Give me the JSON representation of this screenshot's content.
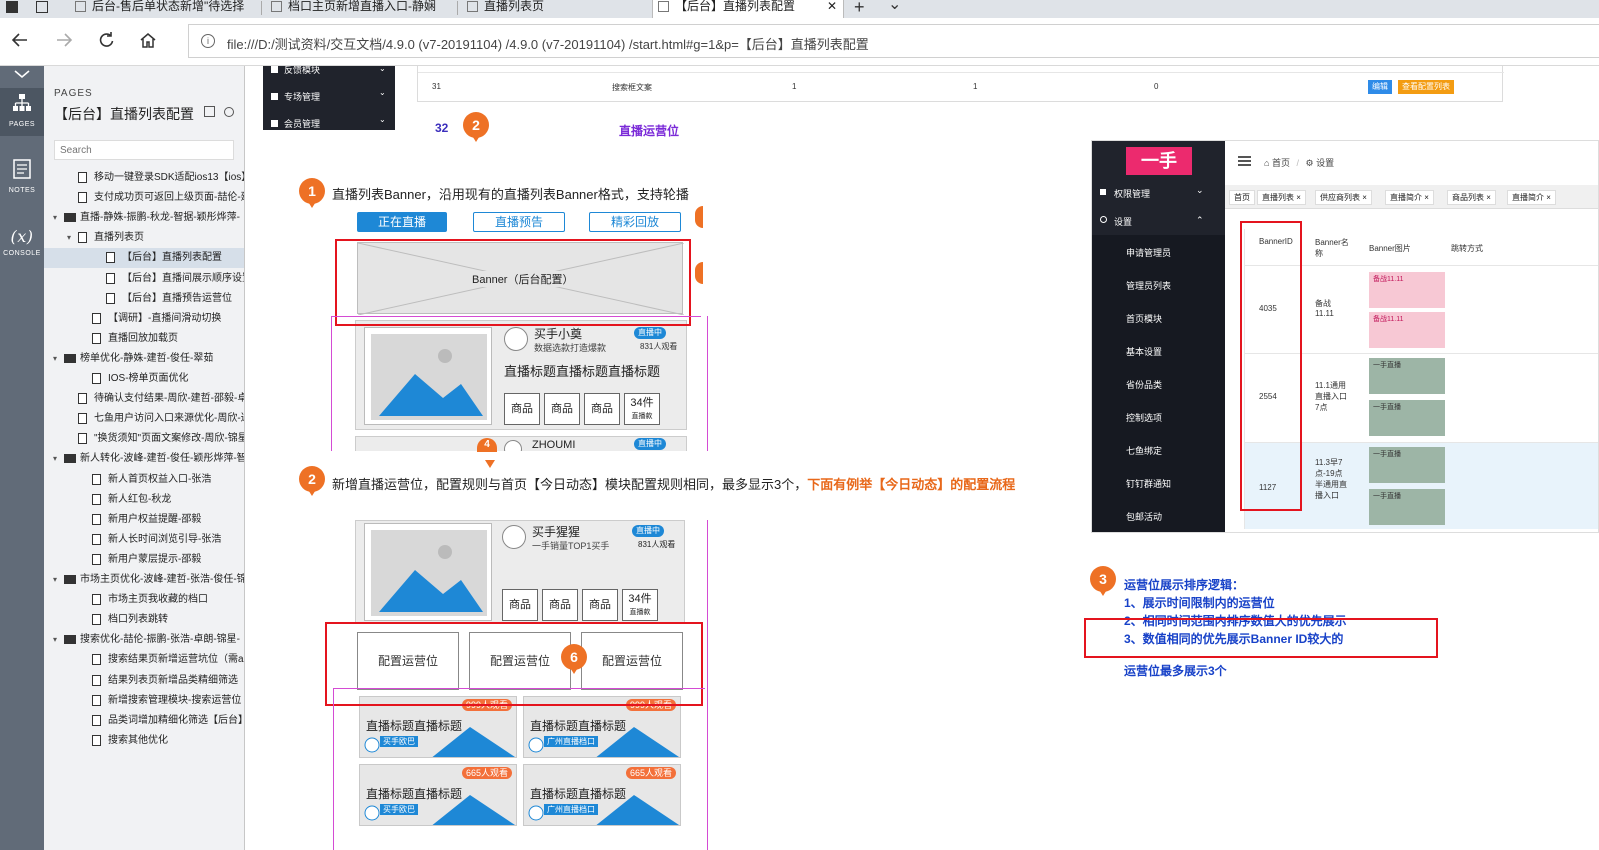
{
  "browser": {
    "tabs": [
      {
        "label": "后台-售后单状态新增\"待选择",
        "active": false
      },
      {
        "label": "档口主页新增直播入口-静娴",
        "active": false
      },
      {
        "label": "直播列表页",
        "active": false
      },
      {
        "label": "【后台】直播列表配置",
        "active": true
      }
    ],
    "new_tab_glyph": "+",
    "tab_menu_glyph": "⌄",
    "close_glyph": "✕",
    "url": "file:///D:/测试资料/交互文档/4.9.0  (v7-20191104)  /4.9.0  (v7-20191104)  /start.html#g=1&p=【后台】直播列表配置",
    "icons": {
      "back": "back-arrow-icon",
      "forward": "forward-arrow-icon",
      "reload": "reload-icon",
      "home": "home-icon",
      "info": "info-icon"
    }
  },
  "rail": {
    "items": [
      {
        "label": "PAGES",
        "icon": "sitemap-icon"
      },
      {
        "label": "NOTES",
        "icon": "notes-icon"
      },
      {
        "label": "CONSOLE",
        "icon": "variable-icon"
      }
    ]
  },
  "pages_panel": {
    "heading": "PAGES",
    "title": "【后台】直播列表配置",
    "search_placeholder": "Search",
    "tree": [
      {
        "label": "移动一键登录SDK适配ios13【ios】-",
        "type": "page",
        "level": 1
      },
      {
        "label": "支付成功页可返回上级页面-喆伦-建舒",
        "type": "page",
        "level": 1
      },
      {
        "label": "直播-静姝-振鹏-秋龙-智据-颖彤烨萍-",
        "type": "folder",
        "level": 0,
        "expanded": true
      },
      {
        "label": "直播列表页",
        "type": "page",
        "level": 1,
        "expanded": true
      },
      {
        "label": "【后台】直播列表配置",
        "type": "page",
        "level": 3,
        "selected": true
      },
      {
        "label": "【后台】直播间展示顺序设置",
        "type": "page",
        "level": 3
      },
      {
        "label": "【后台】直播预告运营位",
        "type": "page",
        "level": 3
      },
      {
        "label": "【调研】-直播间滑动切换",
        "type": "page",
        "level": 2
      },
      {
        "label": "直播回放加载页",
        "type": "page",
        "level": 2
      },
      {
        "label": "榜单优化-静姝-建哲-俊任-翠茹",
        "type": "folder",
        "level": 0,
        "expanded": true
      },
      {
        "label": "IOS-榜单页面优化",
        "type": "page",
        "level": 2
      },
      {
        "label": "待确认支付结果-周欣-建哲-邵毅-卓朗",
        "type": "page",
        "level": 1
      },
      {
        "label": "七鱼用户访问入口来源优化-周欣-达尔",
        "type": "page",
        "level": 1
      },
      {
        "label": "\"换货须知\"页面文案修改-周欣-锦星-锐",
        "type": "page",
        "level": 1
      },
      {
        "label": "新人转化-波峰-建哲-俊任-颖彤烨萍-智",
        "type": "folder",
        "level": 0,
        "expanded": true
      },
      {
        "label": "新人首页权益入口-张浩",
        "type": "page",
        "level": 2
      },
      {
        "label": "新人红包-秋龙",
        "type": "page",
        "level": 2
      },
      {
        "label": "新用户权益提醒-邵毅",
        "type": "page",
        "level": 2
      },
      {
        "label": "新人长时间浏览引导-张浩",
        "type": "page",
        "level": 2
      },
      {
        "label": "新用户蒙层提示-邵毅",
        "type": "page",
        "level": 2
      },
      {
        "label": "市场主页优化-波峰-建哲-张浩-俊任-锦",
        "type": "folder",
        "level": 0,
        "expanded": true
      },
      {
        "label": "市场主页我收藏的档口",
        "type": "page",
        "level": 2
      },
      {
        "label": "档口列表跳转",
        "type": "page",
        "level": 2
      },
      {
        "label": "搜索优化-喆伦-振鹏-张浩-卓朗-锦星-",
        "type": "folder",
        "level": 0,
        "expanded": true
      },
      {
        "label": "搜索结果页新增运营坑位（需ab测",
        "type": "page",
        "level": 2
      },
      {
        "label": "结果列表页新增品类精细筛选（需",
        "type": "page",
        "level": 2
      },
      {
        "label": "新增搜索管理模块-搜索运营位【后",
        "type": "page",
        "level": 2
      },
      {
        "label": "品类词增加精细化筛选【后台】",
        "type": "page",
        "level": 2
      },
      {
        "label": "搜索其他优化",
        "type": "page",
        "level": 2
      }
    ]
  },
  "canvas": {
    "top_menu": [
      "反馈模块",
      "专场管理",
      "会员管理"
    ],
    "table_row": {
      "id": "31",
      "name": "搜索框文案",
      "c3": "1",
      "c4": "1",
      "c5": "0",
      "edit_label": "编辑",
      "view_label": "查看配置列表"
    },
    "row32": {
      "id": "32",
      "label": "直播运营位"
    },
    "note1": {
      "badge": "1",
      "text": "直播列表Banner，沿用现有的直播列表Banner格式，支持轮播"
    },
    "note2": {
      "badge": "2",
      "text": "新增直播运营位，配置规则与首页【今日动态】模块配置规则相同，最多显示3个，",
      "highlight": "下面有例举【今日动态】的配置流程"
    },
    "badge_top": "2",
    "badge6": "6",
    "badge4": "4",
    "mock": {
      "tabs": [
        "正在直播",
        "直播预告",
        "精彩回放"
      ],
      "banner_label": "Banner（后台配置）",
      "room1": {
        "anchor": "买手小奠",
        "desc": "数据选款打造爆款",
        "status": "直播中",
        "viewers": "831人观看",
        "title": "直播标题直播标题直播标题",
        "goods": [
          "商品",
          "商品",
          "商品"
        ],
        "more_count": "34件",
        "more_label": "直播款"
      },
      "room_partial": {
        "anchor": "ZHOUMI",
        "status": "直播中"
      },
      "room2": {
        "anchor": "买手猩猩",
        "desc": "一手销量TOP1买手",
        "status": "直播中",
        "viewers": "831人观看",
        "goods": [
          "商品",
          "商品",
          "商品"
        ],
        "more_count": "34件",
        "more_label": "直播款"
      },
      "op_slots": [
        "配置运营位",
        "配置运营位",
        "配置运营位"
      ],
      "cards": [
        {
          "title": "直播标题直播标题",
          "viewers": "999人观看",
          "shop": "买手欧巴"
        },
        {
          "title": "直播标题直播标题",
          "viewers": "999人观看",
          "shop": "广州直播档口"
        },
        {
          "title": "直播标题直播标题",
          "viewers": "665人观看",
          "shop": "买手欧巴"
        },
        {
          "title": "直播标题直播标题",
          "viewers": "665人观看",
          "shop": "广州直播档口"
        }
      ]
    },
    "admin": {
      "logo": "一手",
      "side_items": [
        "权限管理",
        "设置",
        "申请管理员",
        "管理员列表",
        "首页模块",
        "基本设置",
        "省份品类",
        "控制选项",
        "七鱼绑定",
        "钉钉群通知",
        "包邮活动"
      ],
      "breadcrumb": [
        "首页",
        "设置"
      ],
      "tabs": [
        "首页",
        "直播列表",
        "供应商列表",
        "直播简介",
        "商品列表",
        "直播简介"
      ],
      "headers": [
        "BannerID",
        "Banner名称",
        "Banner图片",
        "跳转方式"
      ],
      "rows": [
        {
          "id": "4035",
          "name": "备战11.11",
          "thumb_text": "备战11.11"
        },
        {
          "id": "2554",
          "name": "11.1通用直播入口7点",
          "thumb_text": "一手直播"
        },
        {
          "id": "1127",
          "name": "11.3早7点-19点半通用直播入口",
          "thumb_text": "一手直播"
        }
      ]
    },
    "note3": {
      "badge": "3",
      "title": "运营位展示排序逻辑：",
      "lines": [
        "1、展示时间限制内的运营位",
        "2、相同时间范围内排序数值大的优先展示",
        "3、数值相同的优先展示Banner  ID较大的"
      ],
      "footer": "运营位最多展示3个"
    },
    "colors": {
      "accent_orange": "#ee7125",
      "red_frame": "#e4141e",
      "blue": "#1e88d6",
      "note_blue": "#1842c8",
      "admin_pink": "#ec2a6e"
    }
  }
}
